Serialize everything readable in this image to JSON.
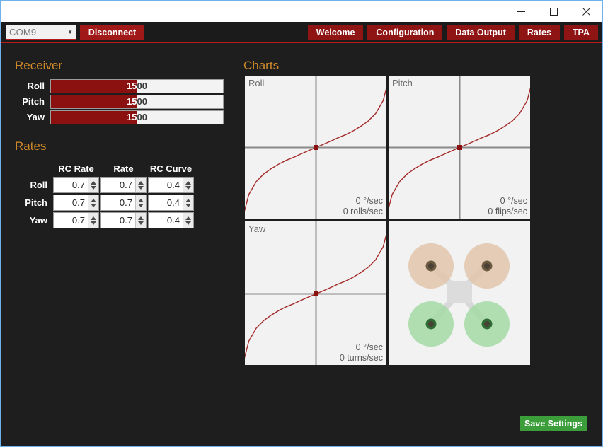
{
  "window": {
    "minimize_label": "minimize-icon",
    "maximize_label": "maximize-icon",
    "close_label": "close-icon"
  },
  "topbar": {
    "port": {
      "value": "COM9",
      "arrow": "▼"
    },
    "disconnect_label": "Disconnect",
    "tabs": [
      {
        "label": "Welcome"
      },
      {
        "label": "Configuration"
      },
      {
        "label": "Data Output"
      },
      {
        "label": "Rates"
      },
      {
        "label": "TPA"
      }
    ]
  },
  "receiver": {
    "title": "Receiver",
    "min": 1000,
    "max": 2000,
    "channels": [
      {
        "label": "Roll",
        "value": "1500",
        "percent": 50
      },
      {
        "label": "Pitch",
        "value": "1500",
        "percent": 50
      },
      {
        "label": "Yaw",
        "value": "1500",
        "percent": 50
      }
    ]
  },
  "rates": {
    "title": "Rates",
    "columns": [
      "RC Rate",
      "Rate",
      "RC Curve"
    ],
    "rows": [
      {
        "label": "Roll",
        "rc_rate": "0.7",
        "rate": "0.7",
        "rc_curve": "0.4"
      },
      {
        "label": "Pitch",
        "rc_rate": "0.7",
        "rate": "0.7",
        "rc_curve": "0.4"
      },
      {
        "label": "Yaw",
        "rc_rate": "0.7",
        "rate": "0.7",
        "rc_curve": "0.4"
      }
    ]
  },
  "charts": {
    "title": "Charts",
    "axis_color": "#8a8a8a",
    "curve_color": "#a52a2a",
    "marker_color": "#8b1010",
    "panels": [
      {
        "name": "Roll",
        "readout_rate": "0 °/sec",
        "readout_spin": "0 rolls/sec"
      },
      {
        "name": "Pitch",
        "readout_rate": "0 °/sec",
        "readout_spin": "0 flips/sec"
      },
      {
        "name": "Yaw",
        "readout_rate": "0 °/sec",
        "readout_spin": "0 turns/sec"
      }
    ],
    "model": {
      "name": "quadcopter-x-diagram",
      "front_prop_color": "#e3c6ac",
      "rear_prop_color": "#a5dba5",
      "arm_color": "#d8d8d8",
      "body_color": "#dcdcdc",
      "motor_color": "#4a4036"
    }
  },
  "chart_data": {
    "type": "line",
    "title": "Rates",
    "xlabel": "",
    "ylabel": "",
    "xlim": [
      -1,
      1
    ],
    "ylim": [
      -1,
      1
    ],
    "grid": false,
    "rc_rate": 0.7,
    "rate": 0.7,
    "rc_curve": 0.4,
    "x": [
      -1,
      -0.9,
      -0.8,
      -0.7,
      -0.6,
      -0.5,
      -0.4,
      -0.3,
      -0.2,
      -0.1,
      0,
      0.1,
      0.2,
      0.3,
      0.4,
      0.5,
      0.6,
      0.7,
      0.8,
      0.9,
      1
    ],
    "series": [
      {
        "name": "Roll",
        "values": [
          -1.0,
          -0.62,
          -0.45,
          -0.35,
          -0.28,
          -0.22,
          -0.17,
          -0.13,
          -0.085,
          -0.042,
          0,
          0.042,
          0.085,
          0.13,
          0.17,
          0.22,
          0.28,
          0.35,
          0.45,
          0.62,
          1.0
        ]
      },
      {
        "name": "Pitch",
        "values": [
          -1.0,
          -0.62,
          -0.45,
          -0.35,
          -0.28,
          -0.22,
          -0.17,
          -0.13,
          -0.085,
          -0.042,
          0,
          0.042,
          0.085,
          0.13,
          0.17,
          0.22,
          0.28,
          0.35,
          0.45,
          0.62,
          1.0
        ]
      },
      {
        "name": "Yaw",
        "values": [
          -1.0,
          -0.62,
          -0.45,
          -0.35,
          -0.28,
          -0.22,
          -0.17,
          -0.13,
          -0.085,
          -0.042,
          0,
          0.042,
          0.085,
          0.13,
          0.17,
          0.22,
          0.28,
          0.35,
          0.45,
          0.62,
          1.0
        ]
      }
    ],
    "marker": {
      "x": 0,
      "y": 0
    },
    "annotations": [
      "0 °/sec",
      "0 rolls/sec",
      "0 flips/sec",
      "0 turns/sec"
    ]
  },
  "footer": {
    "save_label": "Save Settings"
  }
}
